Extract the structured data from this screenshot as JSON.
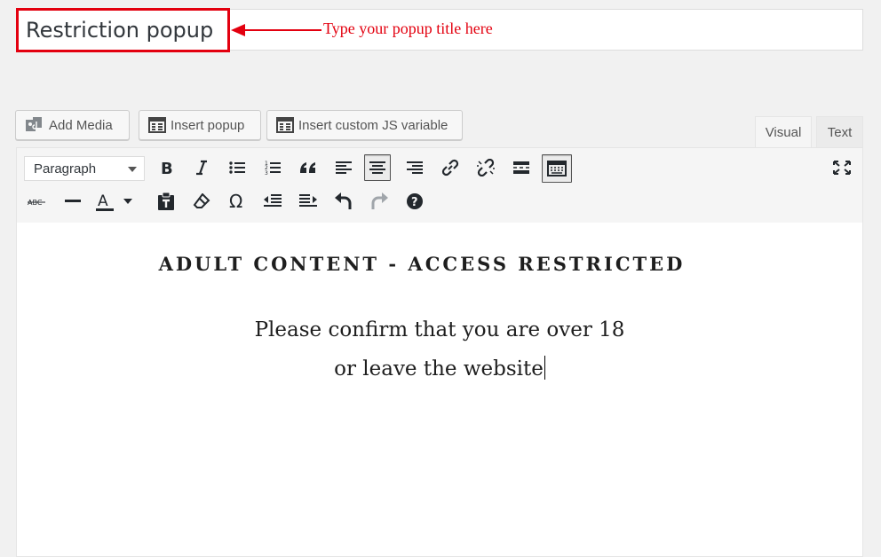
{
  "title": {
    "value": "Restriction popup",
    "annotation": "Type your popup title here",
    "annotation_color": "#e3000f"
  },
  "media_buttons": [
    {
      "label": "Add Media",
      "icon": "add-media-icon"
    },
    {
      "label": "Insert popup",
      "icon": "table-grid-icon"
    },
    {
      "label": "Insert custom JS variable",
      "icon": "table-grid-icon"
    }
  ],
  "tabs": [
    {
      "label": "Visual",
      "active": true
    },
    {
      "label": "Text",
      "active": false
    }
  ],
  "toolbar": {
    "format_select": "Paragraph",
    "row1_icons": [
      "bold-icon",
      "italic-icon",
      "bullet-list-icon",
      "numbered-list-icon",
      "blockquote-icon",
      "align-left-icon",
      "align-center-icon",
      "align-right-icon",
      "link-icon",
      "unlink-icon",
      "read-more-icon",
      "toolbar-toggle-icon",
      "fullscreen-icon"
    ],
    "row2_icons": [
      "strikethrough-icon",
      "horizontal-line-icon",
      "text-color-icon",
      "paste-text-icon",
      "clear-format-icon",
      "special-character-icon",
      "outdent-icon",
      "indent-icon",
      "undo-icon",
      "redo-icon",
      "help-icon"
    ],
    "active": [
      "align-center-icon",
      "toolbar-toggle-icon"
    ]
  },
  "content": {
    "heading": "ADULT CONTENT - ACCESS RESTRICTED",
    "line1": "Please confirm that you are over 18",
    "line2": "or leave the website"
  }
}
